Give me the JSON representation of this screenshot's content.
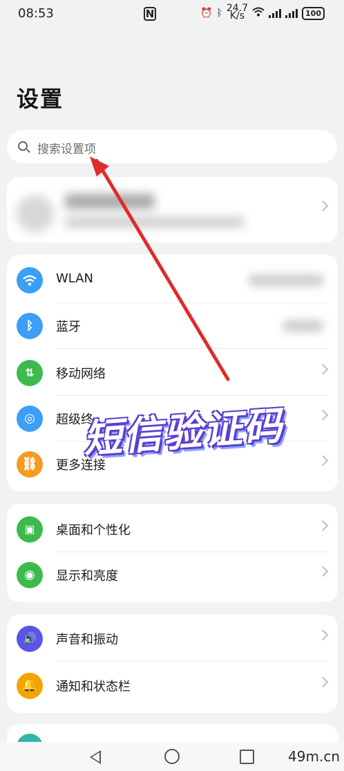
{
  "status_bar": {
    "time": "08:53",
    "nfc_icon": "N",
    "net_speed_value": "24.7",
    "net_speed_unit": "K/s",
    "battery": "100"
  },
  "page_title": "设置",
  "search": {
    "placeholder": "搜索设置项"
  },
  "groups": [
    {
      "items": [
        {
          "label": "WLAN",
          "icon": "wifi-icon",
          "color": "#3a9ff5"
        },
        {
          "label": "蓝牙",
          "icon": "bluetooth-icon",
          "color": "#3a9ff5"
        },
        {
          "label": "移动网络",
          "icon": "mobile-data-icon",
          "color": "#3dba4e"
        },
        {
          "label": "超级终",
          "icon": "super-device-icon",
          "color": "#3a9ff5"
        },
        {
          "label": "更多连接",
          "icon": "link-icon",
          "color": "#f59a23"
        }
      ]
    },
    {
      "items": [
        {
          "label": "桌面和个性化",
          "icon": "wallpaper-icon",
          "color": "#3dba4e"
        },
        {
          "label": "显示和亮度",
          "icon": "eye-icon",
          "color": "#3dba4e"
        }
      ]
    },
    {
      "items": [
        {
          "label": "声音和振动",
          "icon": "speaker-icon",
          "color": "#5a55e8"
        },
        {
          "label": "通知和状态栏",
          "icon": "bell-icon",
          "color": "#f5a300"
        }
      ]
    }
  ],
  "overlay": {
    "text": "短信验证码"
  },
  "watermark": "49m.cn",
  "colors": {
    "background": "#f1f2f4",
    "card": "#ffffff",
    "arrow": "#e02b2b"
  }
}
